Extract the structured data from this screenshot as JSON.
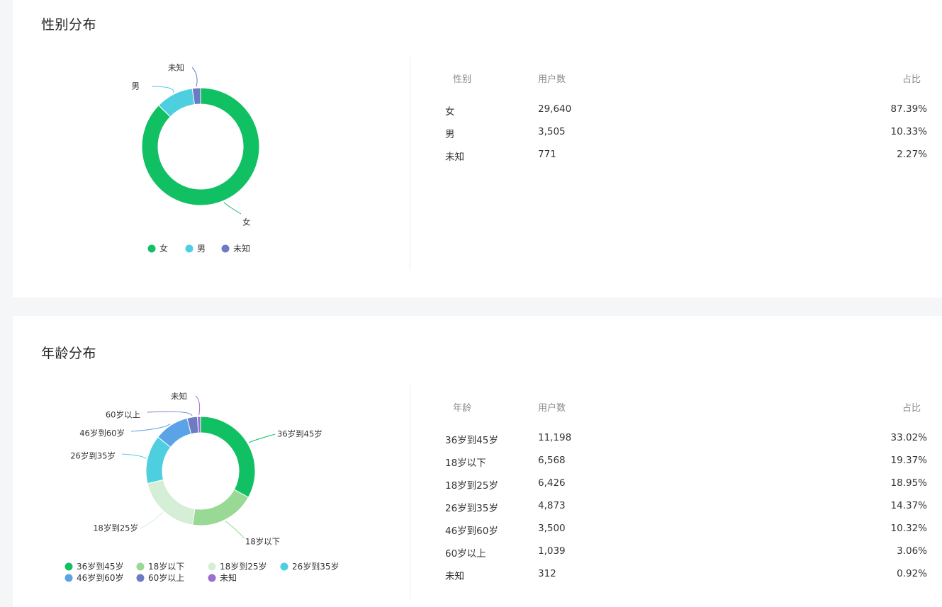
{
  "gender_section": {
    "title": "性别分布",
    "table": {
      "headers": [
        "性别",
        "用户数",
        "占比"
      ],
      "rows": [
        [
          "女",
          "29,640",
          "87.39%"
        ],
        [
          "男",
          "3,505",
          "10.33%"
        ],
        [
          "未知",
          "771",
          "2.27%"
        ]
      ]
    }
  },
  "age_section": {
    "title": "年龄分布",
    "table": {
      "headers": [
        "年龄",
        "用户数",
        "占比"
      ],
      "rows": [
        [
          "36岁到45岁",
          "11,198",
          "33.02%"
        ],
        [
          "18岁以下",
          "6,568",
          "19.37%"
        ],
        [
          "18岁到25岁",
          "6,426",
          "18.95%"
        ],
        [
          "26岁到35岁",
          "4,873",
          "14.37%"
        ],
        [
          "46岁到60岁",
          "3,500",
          "10.32%"
        ],
        [
          "60岁以上",
          "1,039",
          "3.06%"
        ],
        [
          "未知",
          "312",
          "0.92%"
        ]
      ]
    }
  },
  "chart_data": [
    {
      "type": "pie",
      "title": "性别分布",
      "categories": [
        "女",
        "男",
        "未知"
      ],
      "values": [
        29640,
        3505,
        771
      ],
      "colors": [
        "#12c064",
        "#4dcfe0",
        "#6b7bc4"
      ],
      "legend": "bottom"
    },
    {
      "type": "pie",
      "title": "年龄分布",
      "categories": [
        "36岁到45岁",
        "18岁以下",
        "18岁到25岁",
        "26岁到35岁",
        "46岁到60岁",
        "60岁以上",
        "未知"
      ],
      "values": [
        11198,
        6568,
        6426,
        4873,
        3500,
        1039,
        312
      ],
      "colors": [
        "#12c064",
        "#97d995",
        "#d4efd6",
        "#4dcfe0",
        "#5aa3e6",
        "#6b7bc4",
        "#9a6fd2"
      ],
      "legend": "bottom"
    }
  ]
}
